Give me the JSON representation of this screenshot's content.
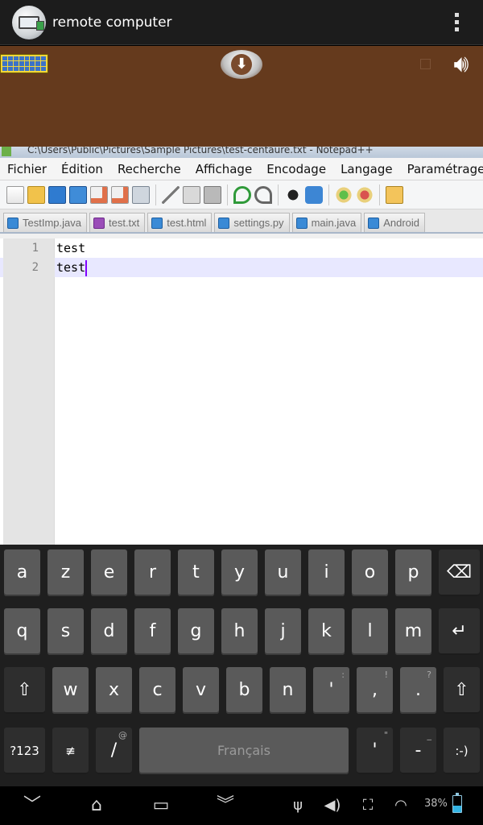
{
  "app_bar": {
    "title": "remote computer",
    "app_icon": "remote-desktop-icon",
    "overflow_icon": "overflow-menu-icon"
  },
  "control_strip": {
    "background": "#653a1d",
    "keyboard_icon": "keyboard-icon",
    "download_icon": "download-arrow-icon",
    "speaker_icon": "speaker-icon"
  },
  "notepad": {
    "window_title": "C:\\Users\\Public\\Pictures\\Sample Pictures\\test-centaure.txt - Notepad++",
    "menu": [
      "Fichier",
      "Édition",
      "Recherche",
      "Affichage",
      "Encodage",
      "Langage",
      "Paramétrage"
    ],
    "tabs": [
      {
        "label": "TestImp.java",
        "icon": "save-icon"
      },
      {
        "label": "test.txt",
        "icon": "save-purple-icon"
      },
      {
        "label": "test.html",
        "icon": "save-icon"
      },
      {
        "label": "settings.py",
        "icon": "save-icon"
      },
      {
        "label": "main.java",
        "icon": "save-icon"
      },
      {
        "label": "Android",
        "icon": "save-icon"
      }
    ],
    "lines": [
      {
        "number": "1",
        "text": "test"
      },
      {
        "number": "2",
        "text": "test"
      }
    ]
  },
  "keyboard": {
    "language": "Français",
    "row1": [
      "a",
      "z",
      "e",
      "r",
      "t",
      "y",
      "u",
      "i",
      "o",
      "p"
    ],
    "row2": [
      "q",
      "s",
      "d",
      "f",
      "g",
      "h",
      "j",
      "k",
      "l",
      "m"
    ],
    "row3": [
      "w",
      "x",
      "c",
      "v",
      "b",
      "n",
      "'",
      ",",
      "."
    ],
    "row3_hints": [
      "",
      "",
      "",
      "",
      "",
      "",
      ":",
      "!",
      "?"
    ],
    "row4": {
      "symbols": "?123",
      "settings_icon": "keyboard-settings-icon",
      "slash": "/",
      "slash_hint": "@",
      "apostrophe": "'",
      "apostrophe_hint": "\"",
      "dash": "-",
      "dash_hint": "_",
      "smiley": ":-)"
    },
    "backspace_icon": "backspace-icon",
    "enter_icon": "enter-icon",
    "shift_icon": "shift-icon"
  },
  "nav_bar": {
    "battery": "38%",
    "icons": [
      "back-icon",
      "home-icon",
      "recent-apps-icon",
      "hide-keyboard-icon",
      "usb-icon",
      "volume-icon",
      "screenshot-icon",
      "wifi-icon"
    ]
  }
}
